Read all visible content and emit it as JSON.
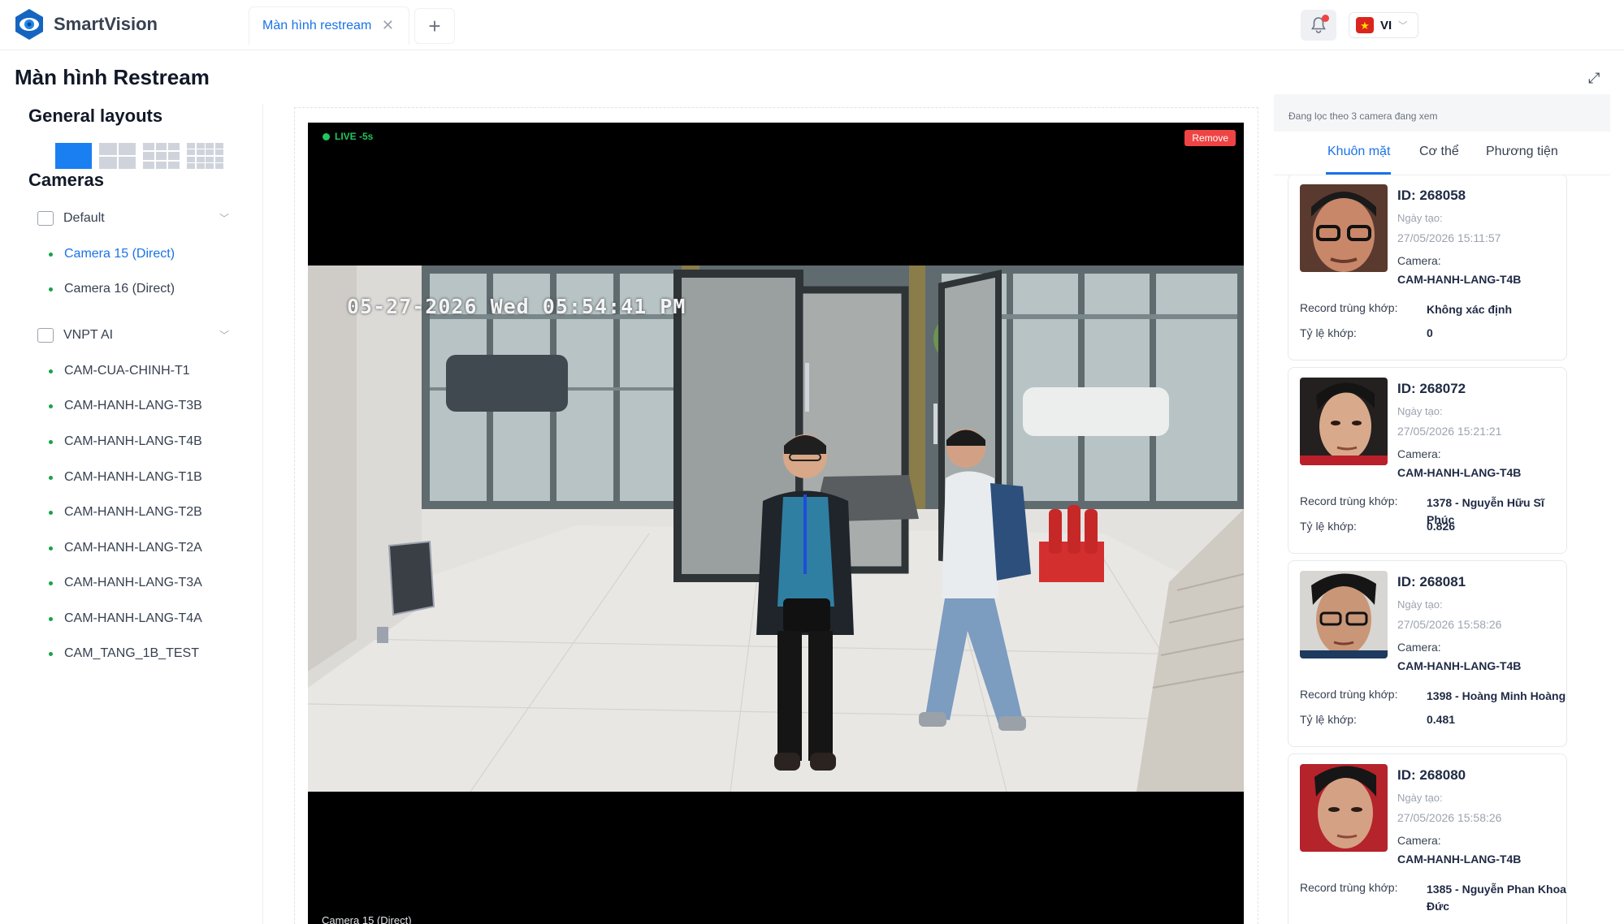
{
  "app": {
    "name": "SmartVision"
  },
  "tabs": [
    {
      "label": "Màn hình restream"
    }
  ],
  "header": {
    "language": "VI"
  },
  "page": {
    "title": "Màn hình Restream"
  },
  "sidebar": {
    "layouts_title": "General layouts",
    "cameras_title": "Cameras",
    "layout_options": [
      "1x1",
      "2x2",
      "3x3",
      "4x4"
    ],
    "selected_layout": "1x1",
    "groups": [
      {
        "name": "Default",
        "cameras": [
          "Camera 15 (Direct)",
          "Camera 16 (Direct)"
        ]
      },
      {
        "name": "VNPT AI",
        "cameras": [
          "CAM-CUA-CHINH-T1",
          "CAM-HANH-LANG-T3B",
          "CAM-HANH-LANG-T4B",
          "CAM-HANH-LANG-T1B",
          "CAM-HANH-LANG-T2B",
          "CAM-HANH-LANG-T2A",
          "CAM-HANH-LANG-T3A",
          "CAM-HANH-LANG-T4A",
          "CAM_TANG_1B_TEST"
        ]
      }
    ],
    "active_camera": "Camera 15 (Direct)"
  },
  "viewer": {
    "live_label": "LIVE -5s",
    "remove_label": "Remove",
    "timestamp": "05-27-2026 Wed 05:54:41 PM",
    "camera_name": "Camera 15 (Direct)"
  },
  "right_panel": {
    "filter_note": "Đang lọc theo 3 camera đang xem",
    "tabs": [
      "Khuôn mặt",
      "Cơ thể",
      "Phương tiện"
    ],
    "active_tab": "Khuôn mặt",
    "labels": {
      "created": "Ngày tạo:",
      "camera": "Camera:",
      "record": "Record trùng khớp:",
      "rate": "Tỷ lệ khớp:"
    },
    "results": [
      {
        "id": "ID: 268058",
        "created": "27/05/2026 15:11:57",
        "camera": "CAM-HANH-LANG-T4B",
        "record": "Không xác định",
        "rate": "0"
      },
      {
        "id": "ID: 268072",
        "created": "27/05/2026 15:21:21",
        "camera": "CAM-HANH-LANG-T4B",
        "record": "1378 - Nguyễn Hữu Sĩ Phúc",
        "rate": "0.826"
      },
      {
        "id": "ID: 268081",
        "created": "27/05/2026 15:58:26",
        "camera": "CAM-HANH-LANG-T4B",
        "record": "1398 - Hoàng Minh Hoàng",
        "rate": "0.481"
      },
      {
        "id": "ID: 268080",
        "created": "27/05/2026 15:58:26",
        "camera": "CAM-HANH-LANG-T4B",
        "record": "1385 - Nguyễn Phan Khoa Đức",
        "rate": ""
      }
    ]
  },
  "colors": {
    "accent": "#1a73e8",
    "live": "#22c55e",
    "remove": "#ef4444"
  }
}
